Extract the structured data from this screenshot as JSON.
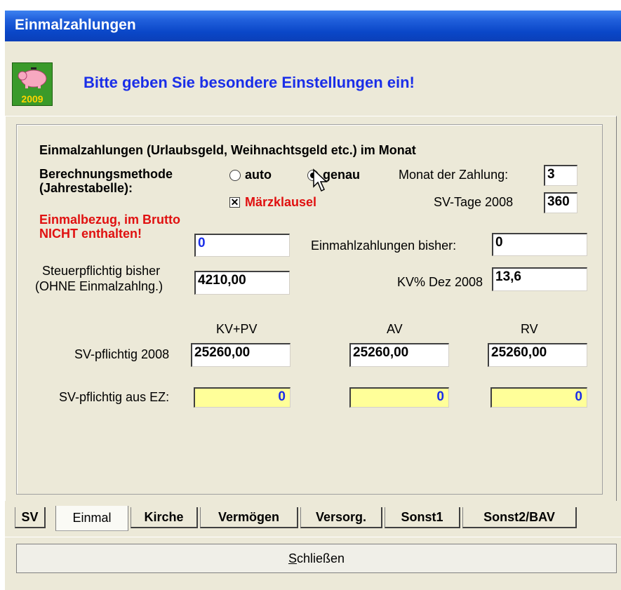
{
  "window": {
    "title": "Einmalzahlungen"
  },
  "header": {
    "message": "Bitte geben Sie besondere Einstellungen ein!",
    "logo_text": "2009"
  },
  "section": {
    "heading": "Einmalzahlungen (Urlaubsgeld, Weihnachtsgeld etc.) im Monat"
  },
  "method": {
    "label_line1": "Berechnungsmethode",
    "label_line2": "(Jahrestabelle):",
    "option_auto": "auto",
    "option_genau": "genau",
    "selected": "genau"
  },
  "maerzklausel": {
    "label": "Märzklausel",
    "checked": true,
    "mark": "✕"
  },
  "monat": {
    "label": "Monat der Zahlung:",
    "value": "3"
  },
  "sv_tage": {
    "label": "SV-Tage 2008",
    "value": "360"
  },
  "einmalbezug": {
    "label_line1": "Einmalbezug, im Brutto",
    "label_line2": "NICHT enthalten!",
    "value": "0"
  },
  "bisher": {
    "label": "Einmahlzahlungen bisher:",
    "value": "0"
  },
  "steuer": {
    "label_line1": "Steuerpflichtig bisher",
    "label_line2": "(OHNE Einmalzahlng.)",
    "value": "4210,00"
  },
  "kv": {
    "label": "KV% Dez 2008",
    "value": "13,6"
  },
  "columns": [
    "KV+PV",
    "AV",
    "RV"
  ],
  "sv_pflichtig": {
    "label": "SV-pflichtig 2008",
    "values": [
      "25260,00",
      "25260,00",
      "25260,00"
    ]
  },
  "sv_ez": {
    "label": "SV-pflichtig aus EZ:",
    "values": [
      "0",
      "0",
      "0"
    ]
  },
  "tabs": [
    {
      "label": "SV"
    },
    {
      "label": "Einmal",
      "active": true
    },
    {
      "label": "Kirche"
    },
    {
      "label": "Vermögen"
    },
    {
      "label": "Versorg."
    },
    {
      "label": "Sonst1"
    },
    {
      "label": "Sonst2/BAV"
    }
  ],
  "footer": {
    "close_label": "Schließen"
  }
}
